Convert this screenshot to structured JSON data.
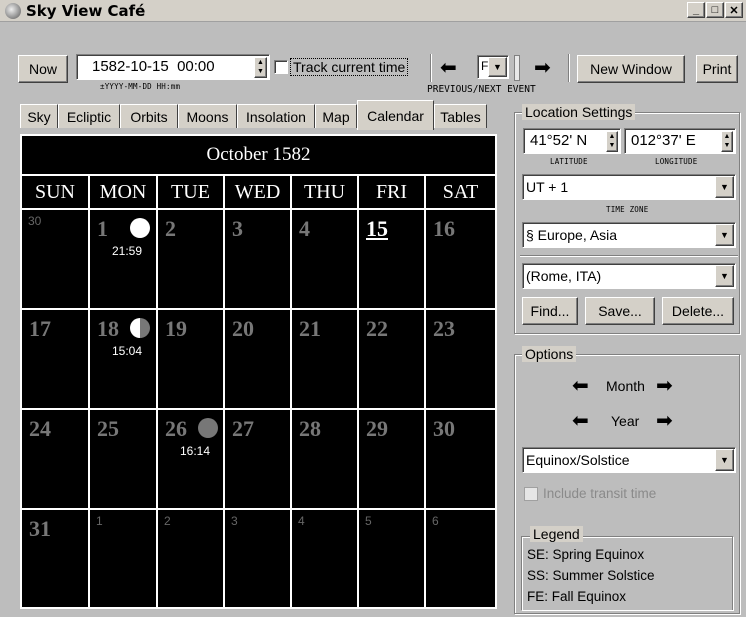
{
  "window": {
    "title": "Sky View Café"
  },
  "toolbar": {
    "now_label": "Now",
    "datetime_value": "1582-10-15  00:00",
    "datetime_hint": "±YYYY-MM-DD HH:mm",
    "track_label": "Track current time",
    "step_value": "F",
    "prevnext_label": "PREVIOUS/NEXT EVENT",
    "new_window_label": "New Window",
    "print_label": "Print"
  },
  "tabs": [
    "Sky",
    "Ecliptic",
    "Orbits",
    "Moons",
    "Insolation",
    "Map",
    "Calendar",
    "Tables"
  ],
  "calendar": {
    "title": "October 1582",
    "weekdays": [
      "SUN",
      "MON",
      "TUE",
      "WED",
      "THU",
      "FRI",
      "SAT"
    ],
    "rows": [
      [
        {
          "d": "30",
          "o": true
        },
        {
          "d": "1",
          "moon": "full",
          "t": "21:59"
        },
        {
          "d": "2"
        },
        {
          "d": "3"
        },
        {
          "d": "4"
        },
        {
          "d": "15",
          "today": true
        },
        {
          "d": "16"
        }
      ],
      [
        {
          "d": "17"
        },
        {
          "d": "18",
          "moon": "first",
          "t": "15:04"
        },
        {
          "d": "19"
        },
        {
          "d": "20"
        },
        {
          "d": "21"
        },
        {
          "d": "22"
        },
        {
          "d": "23"
        }
      ],
      [
        {
          "d": "24"
        },
        {
          "d": "25"
        },
        {
          "d": "26",
          "moon": "new",
          "t": "16:14"
        },
        {
          "d": "27"
        },
        {
          "d": "28"
        },
        {
          "d": "29"
        },
        {
          "d": "30"
        }
      ],
      [
        {
          "d": "31"
        },
        {
          "d": "1",
          "o": true
        },
        {
          "d": "2",
          "o": true
        },
        {
          "d": "3",
          "o": true
        },
        {
          "d": "4",
          "o": true
        },
        {
          "d": "5",
          "o": true
        },
        {
          "d": "6",
          "o": true
        }
      ]
    ]
  },
  "location": {
    "group_title": "Location Settings",
    "latitude_value": "41°52' N",
    "longitude_value": "012°37' E",
    "latitude_caption": "LATITUDE",
    "longitude_caption": "LONGITUDE",
    "timezone_value": "UT + 1",
    "timezone_caption": "TIME ZONE",
    "region_value": "§ Europe, Asia",
    "city_value": "(Rome, ITA)",
    "find_label": "Find...",
    "save_label": "Save...",
    "delete_label": "Delete..."
  },
  "options": {
    "group_title": "Options",
    "month_label": "Month",
    "year_label": "Year",
    "event_value": "Equinox/Solstice",
    "transit_label": "Include transit time"
  },
  "legend": {
    "group_title": "Legend",
    "items": [
      "SE: Spring Equinox",
      "SS: Summer Solstice",
      "FE: Fall Equinox"
    ]
  },
  "colors": {
    "window_bg": "#d4d0c8",
    "calendar_bg": "#000000",
    "accent": "#ffffff"
  }
}
